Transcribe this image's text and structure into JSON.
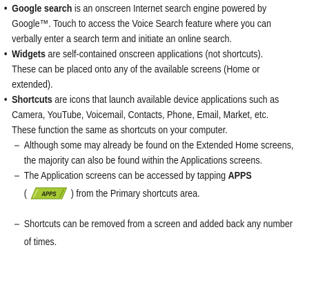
{
  "bullets": [
    {
      "term": "Google search",
      "lines": [
        " is an onscreen Internet search engine powered by",
        "Google™. Touch to access the Voice Search feature where you can",
        "verbally enter a search term and initiate an online search."
      ]
    },
    {
      "term": "Widgets",
      "lines": [
        " are self-contained onscreen applications (not shortcuts).",
        "These can be placed onto any of the available screens (Home or",
        "extended)."
      ]
    },
    {
      "term": "Shortcuts",
      "lines": [
        " are icons that launch available device applications such as",
        "Camera, YouTube, Voicemail, Contacts, Phone, Email, Market, etc.",
        "These function the same as shortcuts on your computer."
      ]
    }
  ],
  "subitems": [
    {
      "lines": [
        "Although some may already be found on the Extended Home screens,",
        "the majority can also be found within the Applications screens."
      ]
    },
    {
      "line1_prefix": "The Application screens can be accessed by tapping ",
      "line1_bold": "APPS",
      "line2_open": "(",
      "icon_label": "APPS",
      "line2_suffix": ") from the Primary shortcuts area."
    },
    {
      "lines": [
        "Shortcuts can be removed from a screen and added back any number",
        "of times."
      ]
    }
  ],
  "symbols": {
    "bullet": "•",
    "dash": "–"
  },
  "colors": {
    "icon_green": "#a6c832",
    "icon_green_dark": "#6f9a14",
    "icon_text": "#1a1a1a"
  }
}
